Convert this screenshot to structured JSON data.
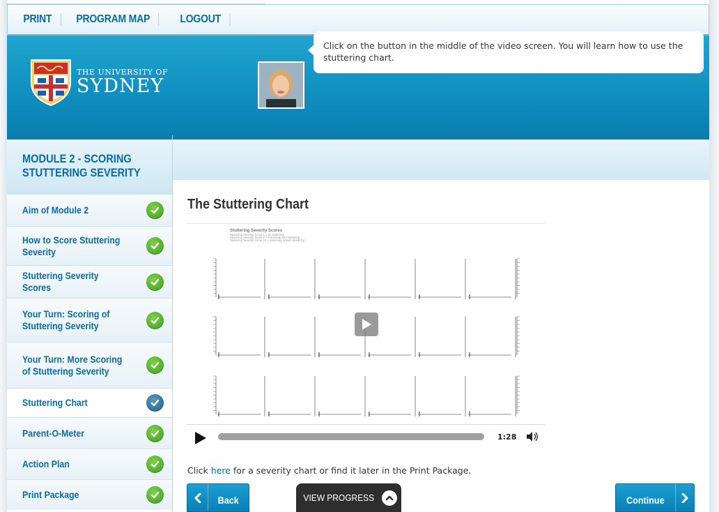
{
  "topnav": {
    "items": [
      {
        "label": "PRINT"
      },
      {
        "label": "PROGRAM MAP"
      },
      {
        "label": "LOGOUT"
      }
    ]
  },
  "header": {
    "logo_small": "THE UNIVERSITY OF",
    "logo_big": "SYDNEY",
    "speech": "Click on the button in the middle of the video screen. You will learn how to use the stuttering chart."
  },
  "sidebar": {
    "module_title": "MODULE 2 - SCORING STUTTERING SEVERITY",
    "items": [
      {
        "label": "Aim of Module 2",
        "status": "complete"
      },
      {
        "label": "How to Score Stuttering Severity",
        "status": "complete"
      },
      {
        "label": "Stuttering Severity Scores",
        "status": "complete"
      },
      {
        "label": "Your Turn: Scoring of Stuttering Severity",
        "status": "complete"
      },
      {
        "label": "Your Turn: More Scoring of Stuttering Severity",
        "status": "complete"
      },
      {
        "label": "Stuttering Chart",
        "status": "current"
      },
      {
        "label": "Parent-O-Meter",
        "status": "complete"
      },
      {
        "label": "Action Plan",
        "status": "complete"
      },
      {
        "label": "Print Package",
        "status": "complete"
      }
    ]
  },
  "main": {
    "title": "The Stuttering Chart",
    "video": {
      "chart_title": "Stuttering Severity Scores",
      "legend_lines": [
        "Stuttering Severity Score 1 = no stuttering",
        "Stuttering Severity Score 2 = extremely mild stuttering",
        "Stuttering Severity Score 10 = extremely severe stuttering"
      ],
      "time": "1:28"
    },
    "footnote_pre": "Click ",
    "footnote_link": "here",
    "footnote_post": " for a severity chart or find it later in the Print Package."
  },
  "buttons": {
    "back": "Back",
    "progress": "VIEW PROGRESS",
    "continue": "Continue"
  },
  "colors": {
    "brand_blue": "#0a7fae",
    "link_blue": "#0b6aa0",
    "check_green": "#3e9c1e",
    "check_current": "#1e5f86"
  }
}
